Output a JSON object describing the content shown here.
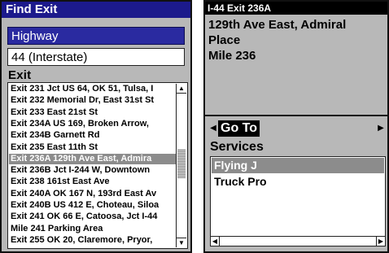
{
  "left_panel": {
    "title": "Find Exit",
    "highway_field": "Highway",
    "route_field": "44 (Interstate)",
    "exit_heading": "Exit",
    "exits": [
      "Exit 231 Jct US 64, OK 51, Tulsa, I",
      "Exit 232 Memorial Dr, East 31st St",
      "Exit 233 East 21st St",
      "Exit 234A US 169, Broken Arrow,",
      "Exit 234B Garnett Rd",
      "Exit 235 East 11th St",
      "Exit 236A 129th Ave East, Admira",
      "Exit 236B Jct I-244 W, Downtown",
      "Exit 238 161st East Ave",
      "Exit 240A OK 167 N, 193rd East Av",
      "Exit 240B US 412 E, Choteau, Siloa",
      "Exit 241 OK 66 E, Catoosa, Jct I-44",
      "Mile 241 Parking Area",
      "Exit 255 OK 20, Claremore, Pryor,"
    ],
    "selected_index": 6
  },
  "right_panel": {
    "exit_title": "I-44 Exit 236A",
    "description_lines": [
      "129th Ave East, Admiral",
      "Place",
      "Mile 236"
    ],
    "goto_label": "Go To",
    "services_heading": "Services",
    "services": [
      "Flying J",
      "Truck Pro"
    ],
    "selected_index": 0
  }
}
